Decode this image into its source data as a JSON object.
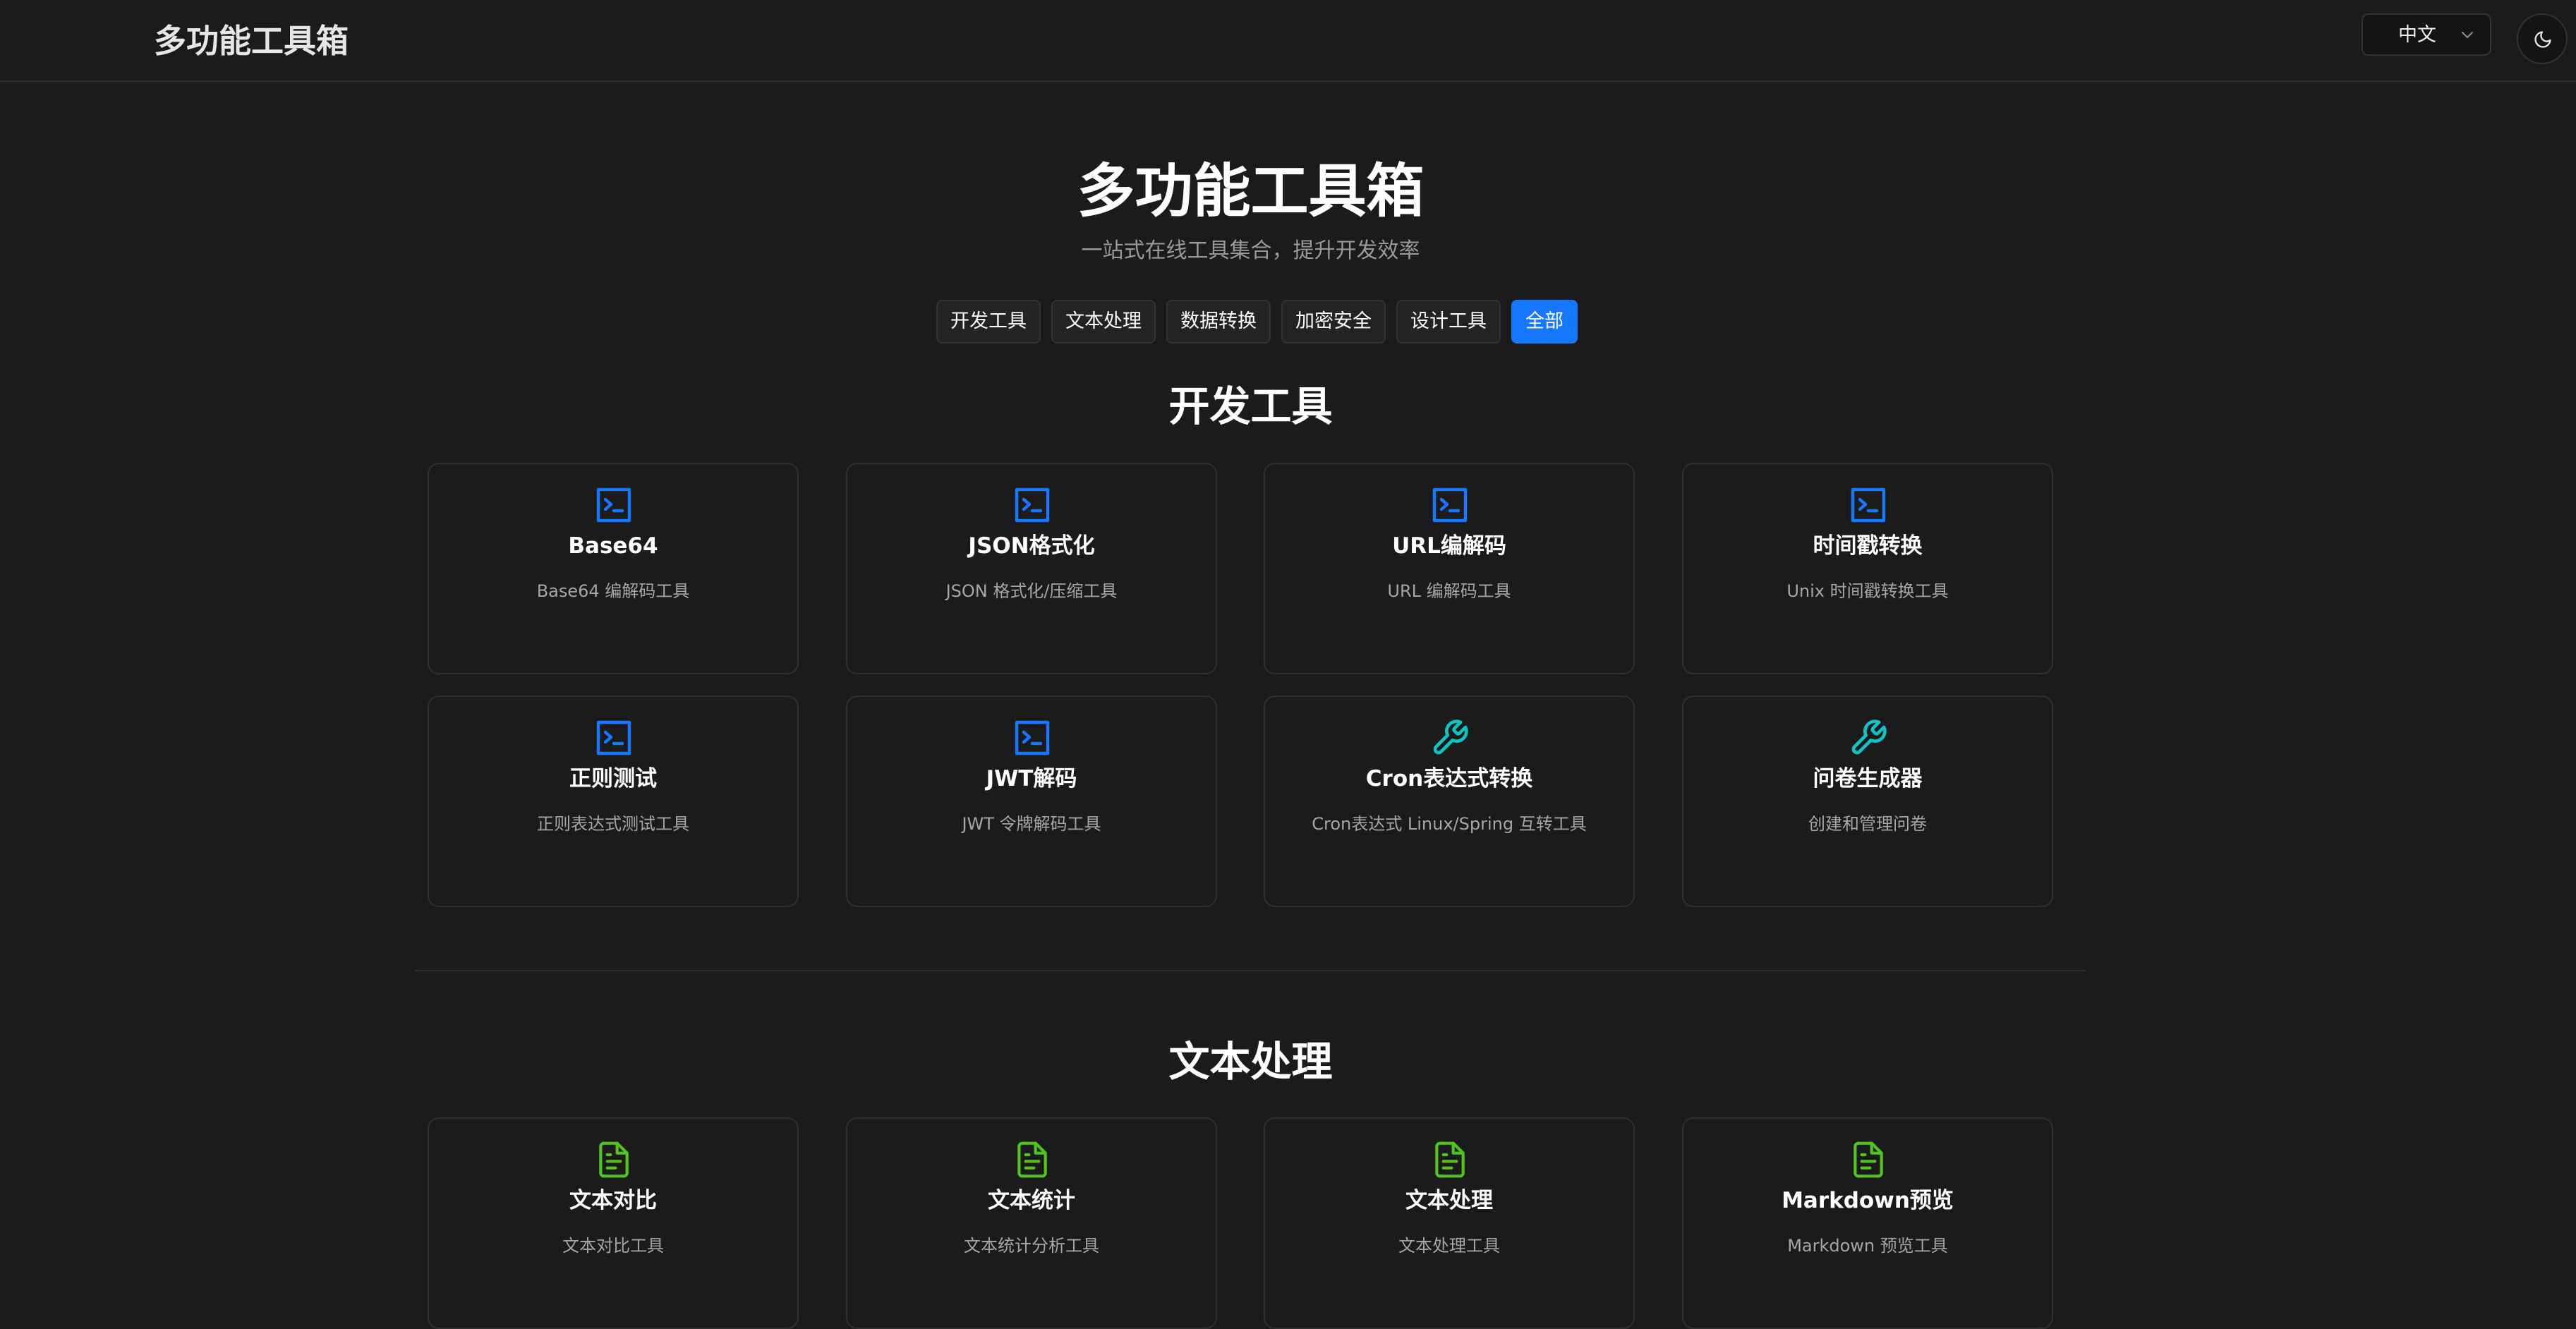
{
  "header": {
    "brand": "多功能工具箱",
    "language": "中文"
  },
  "hero": {
    "title": "多功能工具箱",
    "subtitle": "一站式在线工具集合，提升开发效率"
  },
  "filters": [
    {
      "label": "开发工具",
      "active": false
    },
    {
      "label": "文本处理",
      "active": false
    },
    {
      "label": "数据转换",
      "active": false
    },
    {
      "label": "加密安全",
      "active": false
    },
    {
      "label": "设计工具",
      "active": false
    },
    {
      "label": "全部",
      "active": true
    }
  ],
  "sections": {
    "dev": {
      "title": "开发工具",
      "cards": [
        {
          "title": "Base64",
          "desc": "Base64 编解码工具",
          "icon": "terminal-icon"
        },
        {
          "title": "JSON格式化",
          "desc": "JSON 格式化/压缩工具",
          "icon": "terminal-icon"
        },
        {
          "title": "URL编解码",
          "desc": "URL 编解码工具",
          "icon": "terminal-icon"
        },
        {
          "title": "时间戳转换",
          "desc": "Unix 时间戳转换工具",
          "icon": "terminal-icon"
        },
        {
          "title": "正则测试",
          "desc": "正则表达式测试工具",
          "icon": "terminal-icon"
        },
        {
          "title": "JWT解码",
          "desc": "JWT 令牌解码工具",
          "icon": "terminal-icon"
        },
        {
          "title": "Cron表达式转换",
          "desc": "Cron表达式 Linux/Spring 互转工具",
          "icon": "wrench-icon"
        },
        {
          "title": "问卷生成器",
          "desc": "创建和管理问卷",
          "icon": "wrench-icon"
        }
      ]
    },
    "text": {
      "title": "文本处理",
      "cards": [
        {
          "title": "文本对比",
          "desc": "文本对比工具",
          "icon": "document-icon"
        },
        {
          "title": "文本统计",
          "desc": "文本统计分析工具",
          "icon": "document-icon"
        },
        {
          "title": "文本处理",
          "desc": "文本处理工具",
          "icon": "document-icon"
        },
        {
          "title": "Markdown预览",
          "desc": "Markdown 预览工具",
          "icon": "document-icon"
        }
      ]
    }
  },
  "colors": {
    "accent": "#1677ff",
    "terminal_icon": "#1677ff",
    "wrench_icon": "#13c2c2",
    "document_icon": "#52c41a",
    "background": "#1b1b1b"
  }
}
